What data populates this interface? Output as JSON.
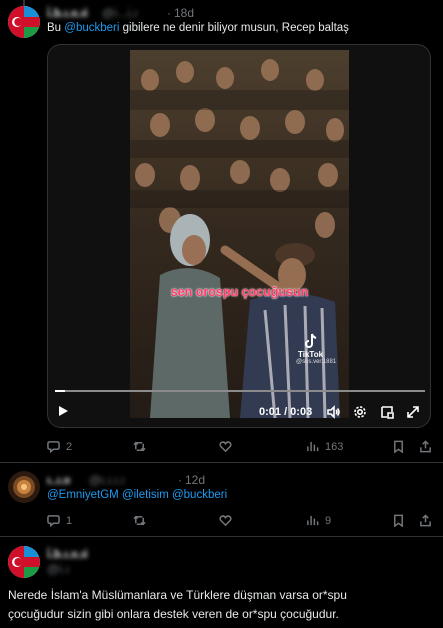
{
  "tweet1": {
    "name": "i̇.b.ı.ıı.ıi",
    "handle": "@ı̇...ı̇.ı",
    "time": "18d",
    "text_prefix": "Bu ",
    "mention": "@buckberi",
    "text_suffix": " gibilere ne denir biliyor musun, Recep baltaş",
    "video": {
      "caption": "sen orospu çocuğusun",
      "watermark_brand": "TikTok",
      "watermark_user": "@ses.ver.1881",
      "time_display": "0:01 / 0:03"
    },
    "actions": {
      "replies": "2",
      "retweets": "",
      "likes": "",
      "views": "163"
    }
  },
  "tweet2": {
    "name": "ı..ı.ıı",
    "handle": "@ı.ı.ı.ı",
    "time": "12d",
    "mentions": [
      "@EmniyetGM",
      "@iletisim",
      "@buckberi"
    ],
    "actions": {
      "replies": "1",
      "retweets": "",
      "likes": "",
      "views": "9"
    }
  },
  "tweet3": {
    "name": "i̇.b.ı.ıı.ıi",
    "handle": "@ı̇.ı",
    "text_line1": "Nerede İslam'a Müslümanlara ve Türklere düşman varsa or*spu",
    "text_line2": "çocuğudur sizin gibi onlara destek veren de or*spu çocuğudur."
  },
  "colors": {
    "background": "#000000",
    "text": "#e7e9ea",
    "muted": "#71767b",
    "link": "#1d9bf0",
    "divider": "#2f3336",
    "caption": "#ff3b6b"
  }
}
